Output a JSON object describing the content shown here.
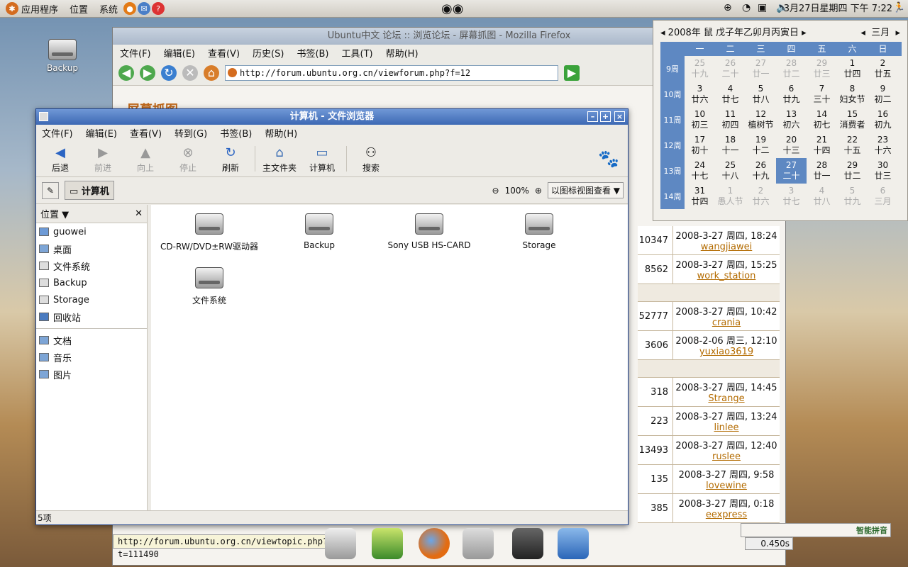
{
  "top_panel": {
    "menu_apps": "应用程序",
    "menu_places": "位置",
    "menu_system": "系统",
    "clock": "3月27日星期四 下午 7:22"
  },
  "desktop": {
    "icons": [
      "Backup"
    ]
  },
  "firefox": {
    "title": "Ubuntu中文 论坛 :: 浏览论坛 - 屏幕抓图 - Mozilla Firefox",
    "menu": [
      "文件(F)",
      "编辑(E)",
      "查看(V)",
      "历史(S)",
      "书签(B)",
      "工具(T)",
      "帮助(H)"
    ],
    "url": "http://forum.ubuntu.org.cn/viewforum.php?f=12",
    "page_heading": "屏幕抓图",
    "status_url": "http://forum.ubuntu.org.cn/viewtopic.php?t=111490",
    "rows": [
      {
        "count": "10347",
        "date": "2008-3-27 周四, 18:24",
        "user": "wangjiawei"
      },
      {
        "count": "8562",
        "date": "2008-3-27 周四, 15:25",
        "user": "work_station"
      },
      {
        "count": "52777",
        "date": "2008-3-27 周四, 10:42",
        "user": "crania"
      },
      {
        "count": "3606",
        "date": "2008-2-06 周三, 12:10",
        "user": "yuxiao3619"
      },
      {
        "count": "318",
        "date": "2008-3-27 周四, 14:45",
        "user": "Strange"
      },
      {
        "count": "223",
        "date": "2008-3-27 周四, 13:24",
        "user": "linlee"
      },
      {
        "count": "13493",
        "date": "2008-3-27 周四, 12:40",
        "user": "ruslee"
      },
      {
        "count": "135",
        "date": "2008-3-27 周四, 9:58",
        "user": "lovewine"
      },
      {
        "count": "385",
        "date": "2008-3-27 周四, 0:18",
        "user": "eexpress"
      }
    ]
  },
  "calendar": {
    "year_label": "2008年 鼠 戊子年乙卯月丙寅日",
    "month_label": "三月",
    "weekdays": [
      "一",
      "二",
      "三",
      "四",
      "五",
      "六",
      "日"
    ],
    "weeks": [
      {
        "wk": "9周",
        "days": [
          [
            "25",
            "十九",
            true
          ],
          [
            "26",
            "二十",
            true
          ],
          [
            "27",
            "廿一",
            true
          ],
          [
            "28",
            "廿二",
            true
          ],
          [
            "29",
            "廿三",
            true
          ],
          [
            "1",
            "廿四",
            false
          ],
          [
            "2",
            "廿五",
            false
          ]
        ]
      },
      {
        "wk": "10周",
        "days": [
          [
            "3",
            "廿六",
            false
          ],
          [
            "4",
            "廿七",
            false
          ],
          [
            "5",
            "廿八",
            false
          ],
          [
            "6",
            "廿九",
            false
          ],
          [
            "7",
            "三十",
            false
          ],
          [
            "8",
            "妇女节",
            false
          ],
          [
            "9",
            "初二",
            false
          ]
        ]
      },
      {
        "wk": "11周",
        "days": [
          [
            "10",
            "初三",
            false
          ],
          [
            "11",
            "初四",
            false
          ],
          [
            "12",
            "植树节",
            false
          ],
          [
            "13",
            "初六",
            false
          ],
          [
            "14",
            "初七",
            false
          ],
          [
            "15",
            "消费者",
            false
          ],
          [
            "16",
            "初九",
            false
          ]
        ]
      },
      {
        "wk": "12周",
        "days": [
          [
            "17",
            "初十",
            false
          ],
          [
            "18",
            "十一",
            false
          ],
          [
            "19",
            "十二",
            false
          ],
          [
            "20",
            "十三",
            false
          ],
          [
            "21",
            "十四",
            false
          ],
          [
            "22",
            "十五",
            false
          ],
          [
            "23",
            "十六",
            false
          ]
        ]
      },
      {
        "wk": "13周",
        "days": [
          [
            "24",
            "十七",
            false
          ],
          [
            "25",
            "十八",
            false
          ],
          [
            "26",
            "十九",
            false
          ],
          [
            "27",
            "二十",
            false
          ],
          [
            "28",
            "廿一",
            false
          ],
          [
            "29",
            "廿二",
            false
          ],
          [
            "30",
            "廿三",
            false
          ]
        ]
      },
      {
        "wk": "14周",
        "days": [
          [
            "31",
            "廿四",
            false
          ],
          [
            "1",
            "愚人节",
            true
          ],
          [
            "2",
            "廿六",
            true
          ],
          [
            "3",
            "廿七",
            true
          ],
          [
            "4",
            "廿八",
            true
          ],
          [
            "5",
            "廿九",
            true
          ],
          [
            "6",
            "三月",
            true
          ]
        ]
      }
    ],
    "today": "27"
  },
  "file_manager": {
    "title": "计算机 - 文件浏览器",
    "menu": [
      "文件(F)",
      "编辑(E)",
      "查看(V)",
      "转到(G)",
      "书签(B)",
      "帮助(H)"
    ],
    "toolbar": {
      "back": "后退",
      "forward": "前进",
      "up": "向上",
      "stop": "停止",
      "reload": "刷新",
      "home": "主文件夹",
      "computer": "计算机",
      "search": "搜索"
    },
    "location": "计算机",
    "zoom": "100%",
    "view_mode": "以图标视图查看",
    "sidebar_title": "位置",
    "sidebar_items": [
      "guowei",
      "桌面",
      "文件系统",
      "Backup",
      "Storage",
      "回收站"
    ],
    "bookmarks": [
      "文档",
      "音乐",
      "图片"
    ],
    "items": [
      "CD-RW/DVD±RW驱动器",
      "Backup",
      "Sony USB HS-CARD",
      "Storage",
      "文件系统"
    ],
    "status": "5项"
  },
  "tray": {
    "ime": "智能拼音",
    "timer": "0.450s"
  }
}
